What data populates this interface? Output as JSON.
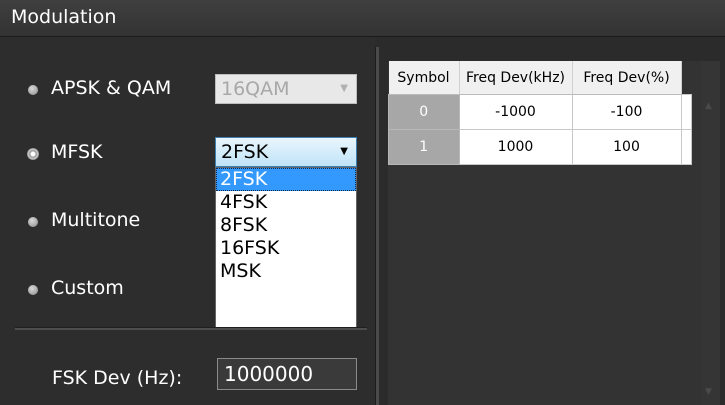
{
  "panel": {
    "title": "Modulation"
  },
  "modes": [
    {
      "label": "APSK & QAM",
      "checked": false
    },
    {
      "label": "MFSK",
      "checked": true
    },
    {
      "label": "Multitone",
      "checked": false
    },
    {
      "label": "Custom",
      "checked": false
    }
  ],
  "apsk_combo": {
    "value": "16QAM",
    "enabled": false
  },
  "mfsk_combo": {
    "value": "2FSK",
    "options": [
      "2FSK",
      "4FSK",
      "8FSK",
      "16FSK",
      "MSK"
    ],
    "highlighted": "2FSK"
  },
  "fsk_dev": {
    "label": "FSK Dev (Hz):",
    "value": "1000000"
  },
  "table": {
    "headers": [
      "Symbol",
      "Freq Dev(kHz)",
      "Freq Dev(%)"
    ],
    "rows": [
      {
        "symbol": "0",
        "freq_dev_khz": "-1000",
        "freq_dev_pct": "-100"
      },
      {
        "symbol": "1",
        "freq_dev_khz": "1000",
        "freq_dev_pct": "100"
      }
    ]
  },
  "colors": {
    "background": "#2b2b2b",
    "dropdown_highlight": "#3399ff",
    "combo_active_border": "#3c7fb1",
    "row_header": "#a7a7a7"
  }
}
